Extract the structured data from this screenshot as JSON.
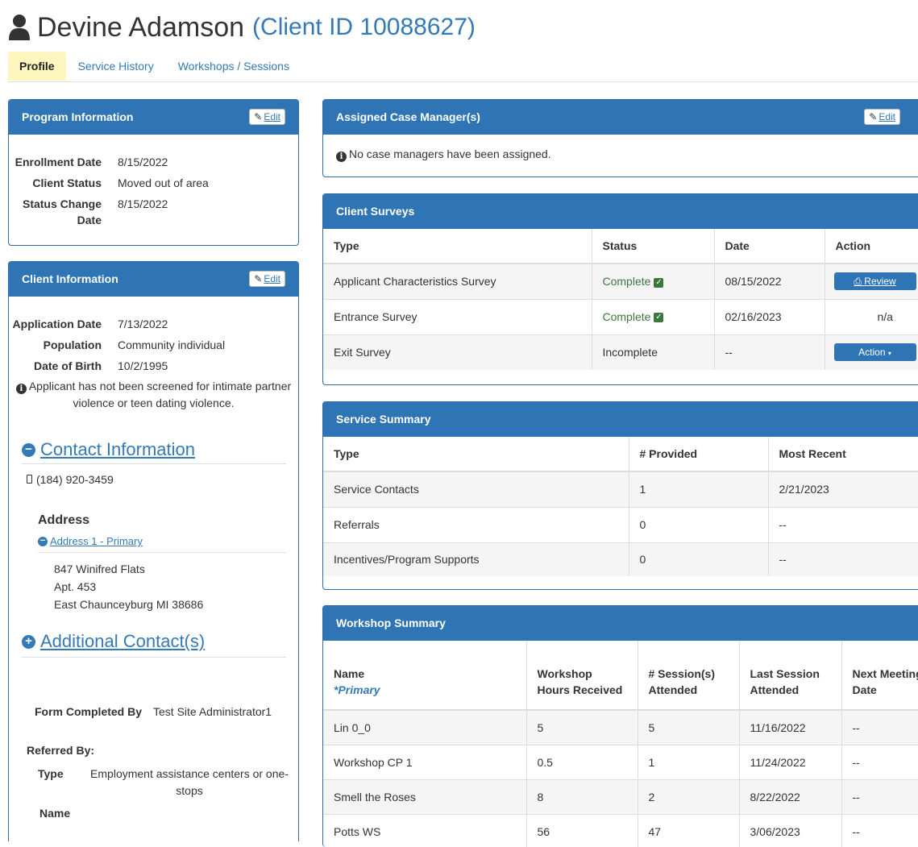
{
  "header": {
    "name": "Devine Adamson",
    "client_id": "(Client ID 10088627)"
  },
  "tabs": [
    {
      "label": "Profile",
      "active": true
    },
    {
      "label": "Service History"
    },
    {
      "label": "Workshops / Sessions"
    }
  ],
  "program_info": {
    "title": "Program Information",
    "edit_label": "Edit",
    "fields": [
      {
        "label": "Enrollment Date",
        "value": "8/15/2022"
      },
      {
        "label": "Client Status",
        "value": "Moved out of area"
      },
      {
        "label": "Status Change Date",
        "value": "8/15/2022"
      }
    ]
  },
  "client_info": {
    "title": "Client Information",
    "edit_label": "Edit",
    "fields": [
      {
        "label": "Application Date",
        "value": "7/13/2022"
      },
      {
        "label": "Population",
        "value": "Community individual"
      },
      {
        "label": "Date of Birth",
        "value": "10/2/1995"
      }
    ],
    "screening_notice": "Applicant has not been screened for intimate partner violence or teen dating violence.",
    "contact_heading": "Contact Information",
    "phone": "(184) 920-3459",
    "address_heading": "Address",
    "address_link": "Address 1 - Primary",
    "address_lines": [
      "847 Winifred Flats",
      "Apt. 453",
      "East Chaunceyburg MI 38686"
    ],
    "additional_heading": "Additional Contact(s)",
    "form_completed_by_label": "Form Completed By",
    "form_completed_by_value": "Test Site Administrator1",
    "referred_by_label": "Referred By:",
    "referred_type_label": "Type",
    "referred_type_value": "Employment assistance centers or one-stops",
    "referred_name_label": "Name"
  },
  "case_managers": {
    "title": "Assigned Case Manager(s)",
    "edit_label": "Edit",
    "notice": "No case managers have been assigned."
  },
  "client_surveys": {
    "title": "Client Surveys",
    "columns": [
      "Type",
      "Status",
      "Date",
      "Action"
    ],
    "rows": [
      {
        "type": "Applicant Characteristics Survey",
        "status": "Complete",
        "date": "08/15/2022",
        "action": "Review"
      },
      {
        "type": "Entrance Survey",
        "status": "Complete",
        "date": "02/16/2023",
        "action": "n/a"
      },
      {
        "type": "Exit Survey",
        "status": "Incomplete",
        "date": "--",
        "action": "Action"
      }
    ]
  },
  "service_summary": {
    "title": "Service Summary",
    "columns": [
      "Type",
      "# Provided",
      "Most Recent"
    ],
    "rows": [
      {
        "type": "Service Contacts",
        "provided": "1",
        "recent": "2/21/2023"
      },
      {
        "type": "Referrals",
        "provided": "0",
        "recent": "--"
      },
      {
        "type": "Incentives/Program Supports",
        "provided": "0",
        "recent": "--"
      }
    ]
  },
  "workshop_summary": {
    "title": "Workshop Summary",
    "col_name": "Name",
    "col_name_sub": "*Primary",
    "col_hours": "Workshop Hours Received",
    "col_sessions": "# Session(s) Attended",
    "col_last": "Last Session Attended",
    "col_next": "Next Meeting Date",
    "rows": [
      {
        "name": "Lin 0_0",
        "hours": "5",
        "sessions": "5",
        "last": "11/16/2022",
        "next": "--"
      },
      {
        "name": "Workshop CP 1",
        "hours": "0.5",
        "sessions": "1",
        "last": "11/24/2022",
        "next": "--"
      },
      {
        "name": "Smell the Roses",
        "hours": "8",
        "sessions": "2",
        "last": "8/22/2022",
        "next": "--"
      },
      {
        "name": "Potts WS",
        "hours": "56",
        "sessions": "47",
        "last": "3/06/2023",
        "next": "--"
      }
    ]
  },
  "icons": {
    "person": "user-icon",
    "pencil": "pencil-icon",
    "info": "info-circle-icon",
    "minus": "minus-circle-icon",
    "plus": "plus-circle-icon",
    "phone": "mobile-phone-icon",
    "print": "print-icon",
    "check": "check-square-icon",
    "caret": "caret-down-icon"
  },
  "colors": {
    "panel_heading": "#2f75b5",
    "link": "#337ab7",
    "active_tab": "#fdf6bf",
    "complete": "#3c763d"
  }
}
